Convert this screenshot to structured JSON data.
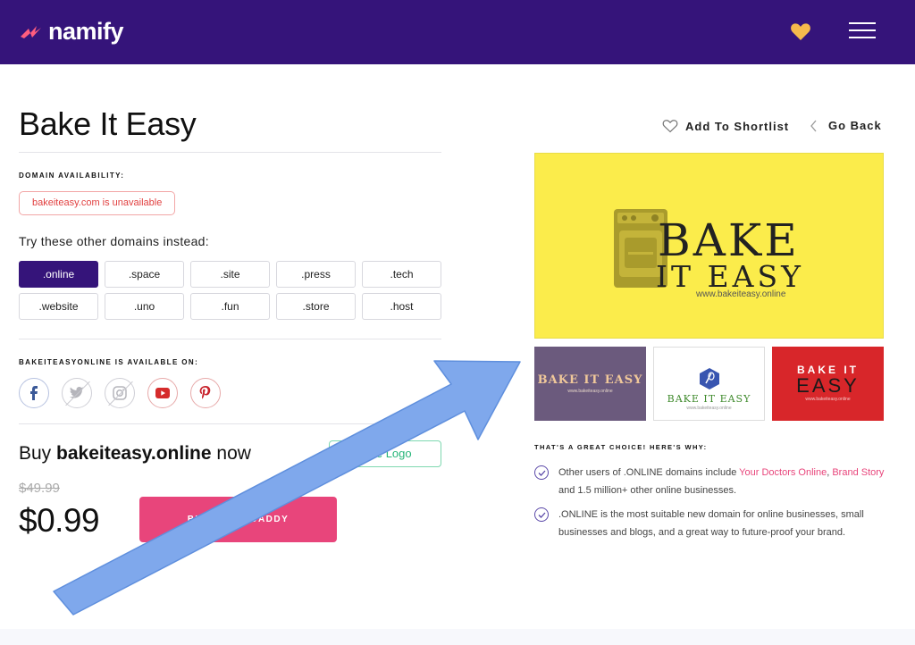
{
  "header": {
    "brand": "namify",
    "colors": {
      "bar": "#35147a",
      "heart": "#f6b94c"
    }
  },
  "page": {
    "title": "Bake It Easy",
    "shortlist_label": "Add To Shortlist",
    "goback_label": "Go Back"
  },
  "domain": {
    "availability_label": "DOMAIN AVAILABILITY:",
    "status": "bakeiteasy.com is unavailable",
    "try_text": "Try these other domains instead:",
    "tlds": [
      ".online",
      ".space",
      ".site",
      ".press",
      ".tech",
      ".website",
      ".uno",
      ".fun",
      ".store",
      ".host"
    ],
    "selected": ".online"
  },
  "social": {
    "label": "BAKEITEASYONLINE IS AVAILABLE ON:",
    "icons": [
      "facebook-icon",
      "twitter-icon",
      "instagram-icon",
      "youtube-icon",
      "pinterest-icon"
    ]
  },
  "buy": {
    "prefix": "Buy ",
    "domain": "bakeiteasy.online",
    "suffix": " now",
    "free_logo": "Free Logo",
    "old_price": "$49.99",
    "price": "$0.99",
    "button": "BUY ON GODADDY"
  },
  "logos": {
    "main": {
      "line1": "BAKE",
      "line2": "IT EASY",
      "url": "www.bakeiteasy.online",
      "bg": "#fbec4b"
    },
    "thumb1": {
      "text": "BAKE IT EASY",
      "url": "www.bakeiteasy.online"
    },
    "thumb2": {
      "text": "BAKE IT EASY",
      "url": "www.bakeiteasy.online"
    },
    "thumb3": {
      "line1": "BAKE IT",
      "line2": "EASY",
      "url": "www.bakeiteasy.online"
    }
  },
  "reasons": {
    "label": "THAT'S A GREAT CHOICE! HERE'S WHY:",
    "r1_pre": "Other users of .ONLINE domains include ",
    "r1_link1": "Your Doctors Online",
    "r1_sep": ", ",
    "r1_link2": "Brand Story",
    "r1_post": " and 1.5 million+ other online businesses.",
    "r2": ".ONLINE is the most suitable new domain for online businesses, small businesses and blogs, and a great way to future-proof your brand."
  },
  "overlay": {
    "arrow_color": "#7fa8ec"
  }
}
